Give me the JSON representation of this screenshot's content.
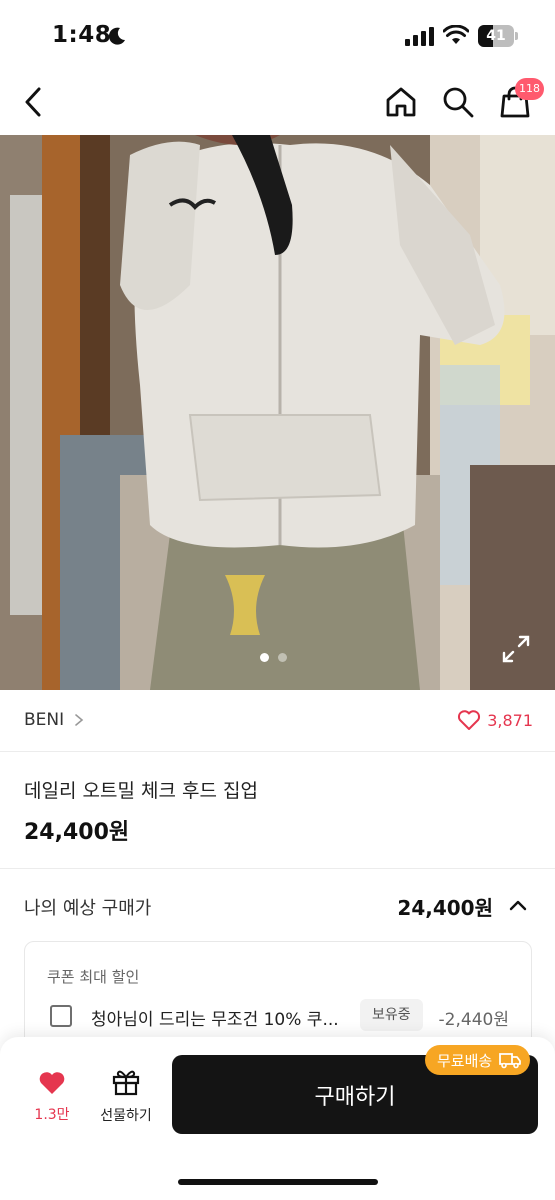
{
  "status": {
    "time": "1:48",
    "battery": "41",
    "battery_level": 0.41
  },
  "header": {
    "cart_badge": "118"
  },
  "product_image": {
    "pagination_total": 2,
    "pagination_active": 1
  },
  "brand": {
    "name": "BENI",
    "like_count": "3,871"
  },
  "product": {
    "title": "데일리 오트밀 체크 후드 집업",
    "price": "24,400원"
  },
  "expected_price": {
    "label": "나의 예상 구매가",
    "value": "24,400원"
  },
  "coupon": {
    "header": "쿠폰 최대 할인",
    "name": "청아님이 드리는 무조건 10% 쿠...",
    "owned_label": "보유중",
    "discount": "-2,440원"
  },
  "bottom_bar": {
    "like_count": "1.3만",
    "gift_label": "선물하기",
    "buy_label": "구매하기",
    "free_shipping_label": "무료배송"
  },
  "colors": {
    "accent_pink": "#e5364f",
    "buy_button": "#141414",
    "free_shipping_badge": "#f7a623",
    "cart_badge": "#ff5a6e"
  }
}
